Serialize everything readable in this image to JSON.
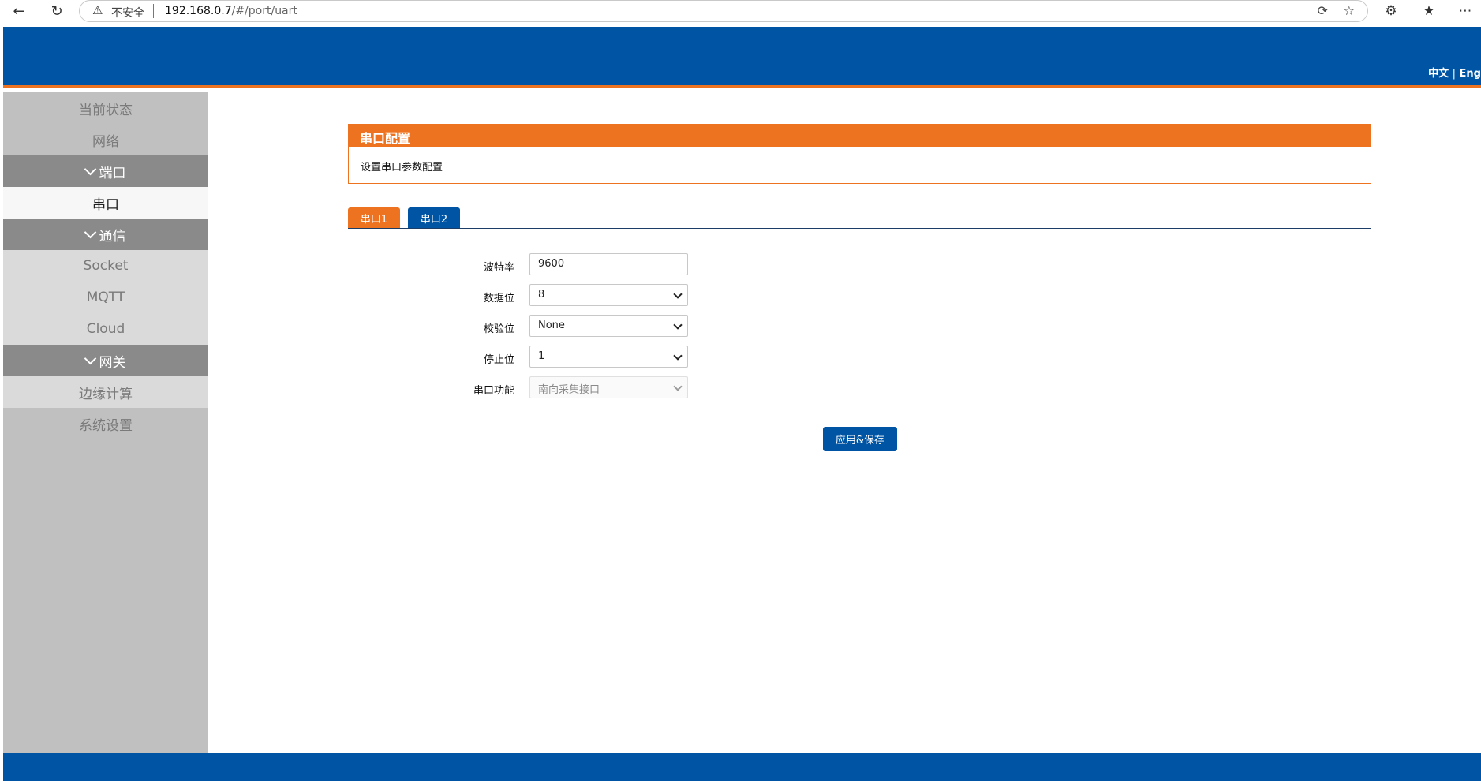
{
  "browser": {
    "security_label": "不安全",
    "url_host": "192.168.0.7",
    "url_path": "/#/port/uart"
  },
  "header": {
    "lang_zh": "中文",
    "lang_sep": "|",
    "lang_en": "Eng"
  },
  "sidebar": {
    "items": [
      {
        "label": "当前状态"
      },
      {
        "label": "网络"
      },
      {
        "label": "端口"
      },
      {
        "label": "串口"
      },
      {
        "label": "通信"
      },
      {
        "label": "Socket"
      },
      {
        "label": "MQTT"
      },
      {
        "label": "Cloud"
      },
      {
        "label": "网关"
      },
      {
        "label": "边缘计算"
      },
      {
        "label": "系统设置"
      }
    ]
  },
  "panel": {
    "title": "串口配置",
    "description": "设置串口参数配置"
  },
  "tabs": [
    {
      "label": "串口1"
    },
    {
      "label": "串口2"
    }
  ],
  "form": {
    "baud_label": "波特率",
    "baud_value": "9600",
    "databits_label": "数据位",
    "databits_value": "8",
    "parity_label": "校验位",
    "parity_value": "None",
    "stopbits_label": "停止位",
    "stopbits_value": "1",
    "function_label": "串口功能",
    "function_value": "南向采集接口"
  },
  "actions": {
    "save_label": "应用&保存"
  },
  "colors": {
    "brand_blue": "#0054a4",
    "accent_orange": "#ee7320"
  }
}
